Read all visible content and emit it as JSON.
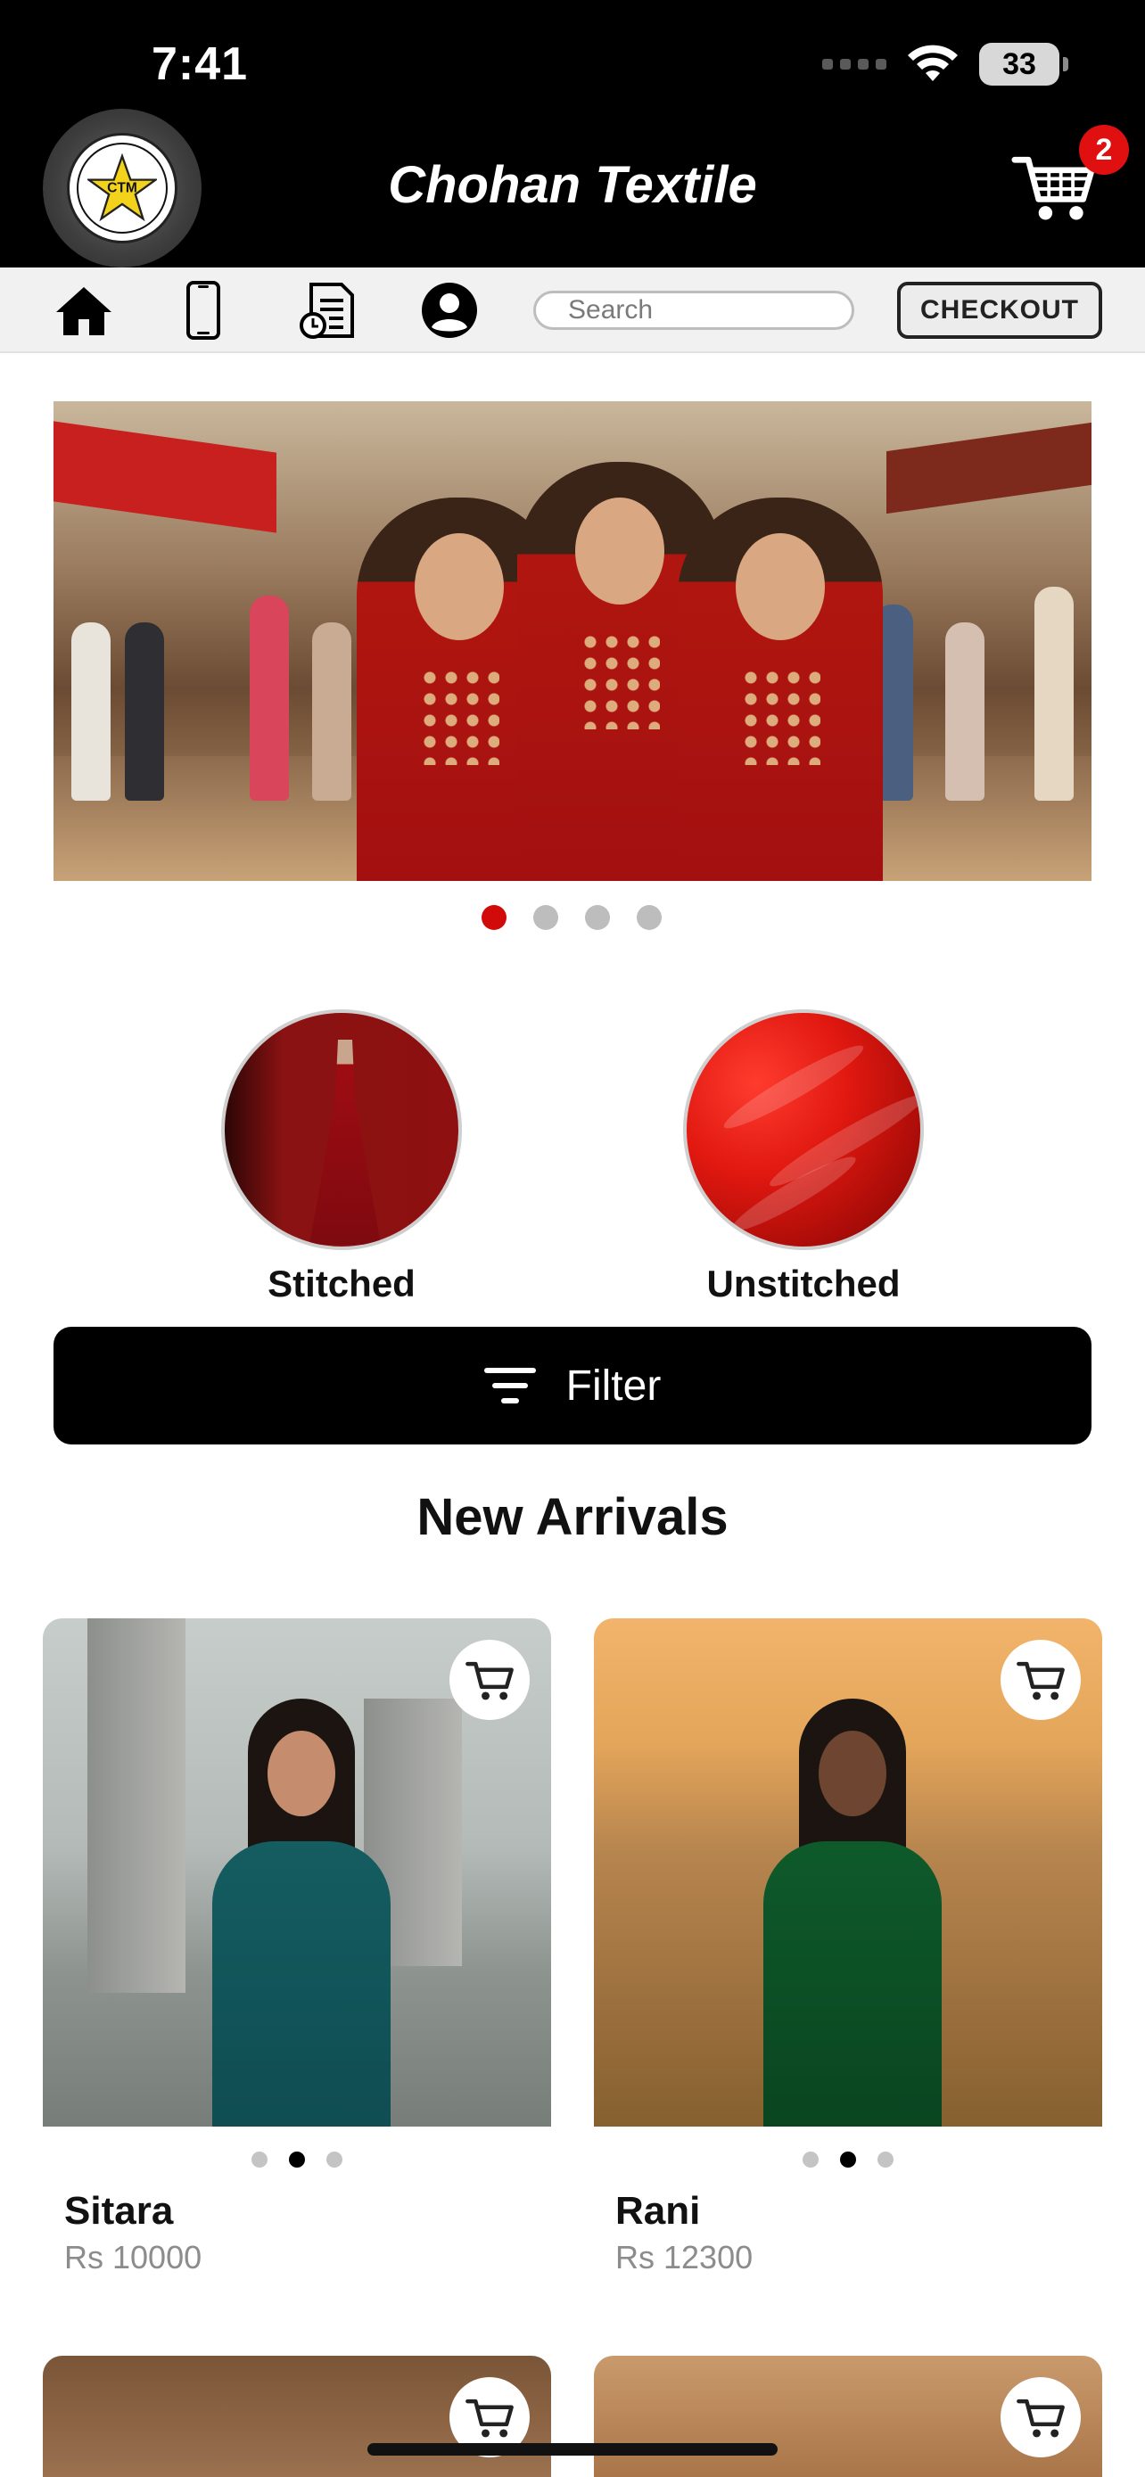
{
  "status_bar": {
    "time": "7:41",
    "battery": "33"
  },
  "header": {
    "title": "Chohan Textile",
    "cart_count": "2",
    "logo_text": "CHOHAN TEXTILE"
  },
  "toolbar": {
    "icons": [
      "home-icon",
      "phone-icon",
      "orders-icon",
      "account-icon"
    ],
    "search_placeholder": "Search",
    "checkout_label": "CHECKOUT"
  },
  "banner": {
    "slide_count": 4,
    "active_slide": 1
  },
  "categories": [
    {
      "label": "Stitched"
    },
    {
      "label": "Unstitched"
    }
  ],
  "filter": {
    "label": "Filter"
  },
  "section": {
    "title": "New Arrivals"
  },
  "products": [
    {
      "name": "Sitara",
      "price": "Rs 10000",
      "image_count": 3,
      "active_image": 2
    },
    {
      "name": "Rani",
      "price": "Rs 12300",
      "image_count": 3,
      "active_image": 2
    }
  ],
  "colors": {
    "accent": "#d10a0a",
    "header_bg": "#000000",
    "badge": "#e01010"
  }
}
